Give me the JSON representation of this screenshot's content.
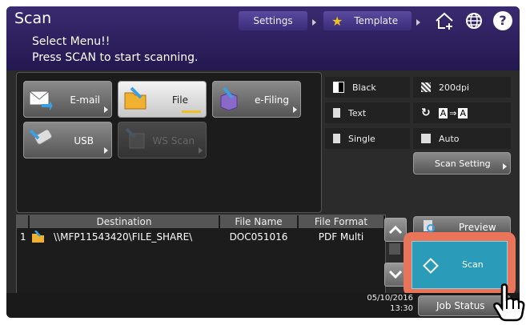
{
  "header": {
    "title": "Scan",
    "message_line1": "Select Menu!!",
    "message_line2": "Press SCAN to start scanning.",
    "settings_label": "Settings",
    "template_label": "Template"
  },
  "menu": {
    "email": "E-mail",
    "file": "File",
    "efiling": "e-Filing",
    "usb": "USB",
    "ws_scan": "WS Scan"
  },
  "settings": {
    "color": "Black",
    "resolution": "200dpi",
    "mode": "Text",
    "sides": "Single",
    "size": "Auto",
    "scan_setting": "Scan Setting"
  },
  "table": {
    "headers": [
      "Destination",
      "File Name",
      "File Format"
    ],
    "rows": [
      {
        "num": "1",
        "destination": "\\\\MFP11543420\\FILE_SHARE\\",
        "filename": "DOC051016",
        "format": "PDF Multi"
      }
    ]
  },
  "actions": {
    "preview": "Preview",
    "scan": "Scan",
    "job_status": "Job Status"
  },
  "status": {
    "date": "05/10/2016",
    "time": "13:30"
  },
  "colors": {
    "header": "#2e2260",
    "scan_button": "#2a9bb8",
    "highlight": "#e8745a"
  }
}
